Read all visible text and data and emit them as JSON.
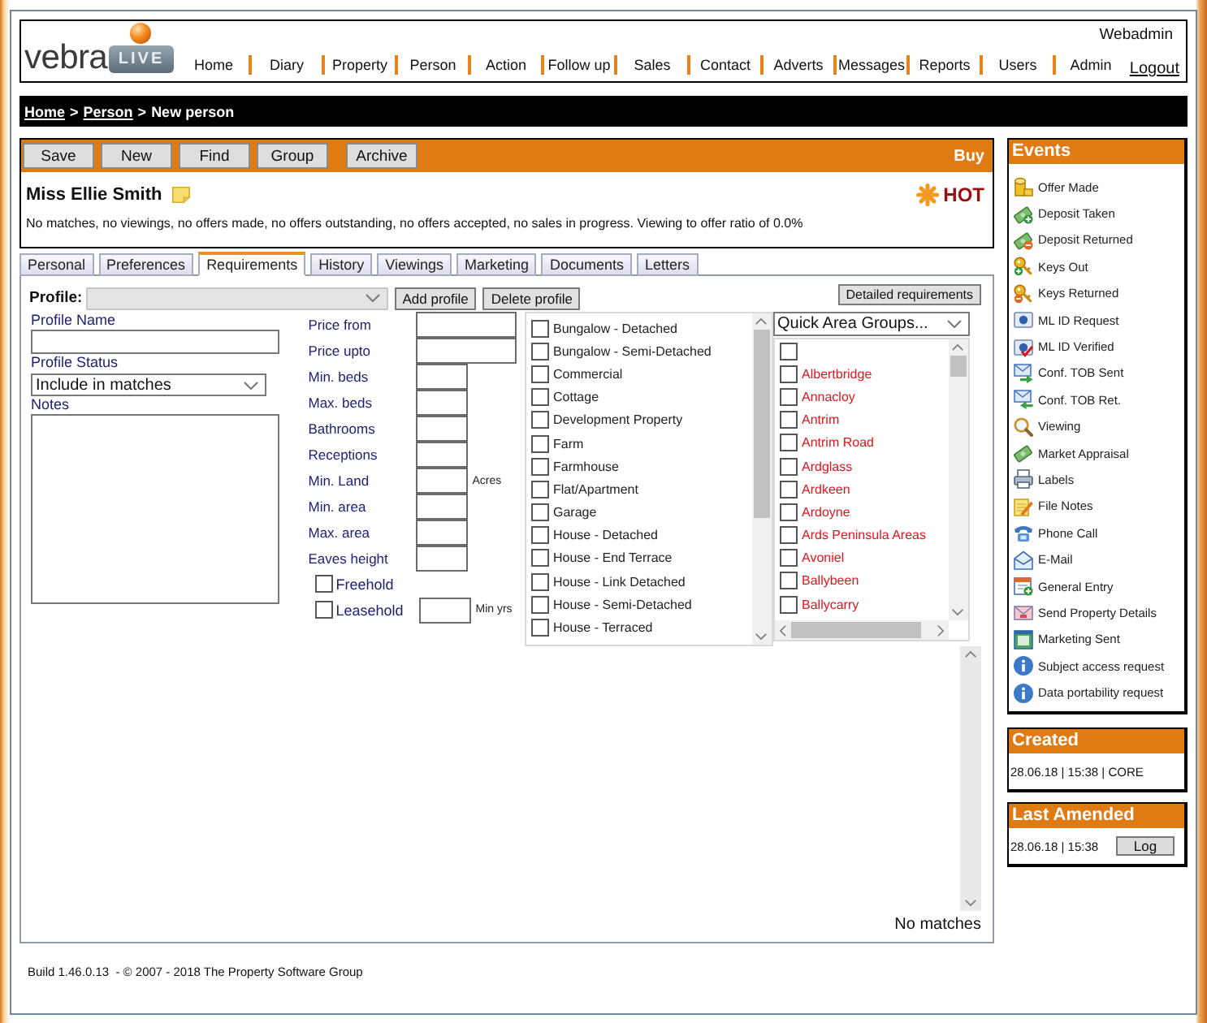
{
  "header": {
    "logo": {
      "wordmark": "vebra",
      "badge": "LIVE"
    },
    "nav": [
      "Home",
      "Diary",
      "Property",
      "Person",
      "Action",
      "Follow up",
      "Sales",
      "Contact",
      "Adverts",
      "Messages",
      "Reports",
      "Users",
      "Admin"
    ],
    "user": "Webadmin",
    "logout": "Logout"
  },
  "breadcrumb": [
    {
      "label": "Home",
      "kind": "link"
    },
    {
      "label": ">",
      "kind": "separator"
    },
    {
      "label": "Person",
      "kind": "link"
    },
    {
      "label": ">",
      "kind": "separator"
    },
    {
      "label": "New person",
      "kind": "current"
    }
  ],
  "toolbar": {
    "button_groups": [
      [
        "Save",
        "New",
        "Find",
        "Group"
      ],
      [
        "Archive"
      ]
    ],
    "mode": "Buy"
  },
  "person": {
    "name": "Miss Ellie Smith",
    "status": "HOT",
    "summary": "No matches, no viewings, no offers made, no offers outstanding, no offers accepted, no sales in progress. Viewing to offer ratio of 0.0%"
  },
  "tabs": [
    {
      "label": "Personal",
      "selected": false
    },
    {
      "label": "Preferences",
      "selected": false
    },
    {
      "label": "Requirements",
      "selected": true
    },
    {
      "label": "History",
      "selected": false
    },
    {
      "label": "Viewings",
      "selected": false
    },
    {
      "label": "Marketing",
      "selected": false
    },
    {
      "label": "Documents",
      "selected": false
    },
    {
      "label": "Letters",
      "selected": false
    }
  ],
  "requirements": {
    "profile": {
      "label": "Profile:",
      "disabled": true
    },
    "profile_buttons": [
      "Add profile",
      "Delete profile"
    ],
    "detailed_button": "Detailed requirements",
    "profile_name": {
      "label": "Profile Name"
    },
    "profile_status": {
      "label": "Profile Status",
      "value": "Include in matches"
    },
    "notes": {
      "label": "Notes"
    },
    "criteria": [
      {
        "label": "Price from",
        "kind": "wide"
      },
      {
        "label": "Price upto",
        "kind": "wide"
      },
      {
        "label": "Min. beds",
        "kind": "narrow"
      },
      {
        "label": "Max. beds",
        "kind": "narrow"
      },
      {
        "label": "Bathrooms",
        "kind": "narrow"
      },
      {
        "label": "Receptions",
        "kind": "narrow"
      },
      {
        "label": "Min. Land",
        "kind": "narrow",
        "unit": "Acres"
      },
      {
        "label": "Min. area",
        "kind": "narrow"
      },
      {
        "label": "Max. area",
        "kind": "narrow"
      },
      {
        "label": "Eaves height",
        "kind": "narrow"
      }
    ],
    "tenure": [
      {
        "label": "Freehold",
        "checked": false
      },
      {
        "label": "Leasehold",
        "checked": false,
        "unit": "Min yrs"
      }
    ],
    "property_types": [
      {
        "label": "Bungalow - Detached",
        "checked": false
      },
      {
        "label": "Bungalow - Semi-Detached",
        "checked": false
      },
      {
        "label": "Commercial",
        "checked": false
      },
      {
        "label": "Cottage",
        "checked": false
      },
      {
        "label": "Development Property",
        "checked": false
      },
      {
        "label": "Farm",
        "checked": false
      },
      {
        "label": "Farmhouse",
        "checked": false
      },
      {
        "label": "Flat/Apartment",
        "checked": false
      },
      {
        "label": "Garage",
        "checked": false
      },
      {
        "label": "House - Detached",
        "checked": false
      },
      {
        "label": "House - End Terrace",
        "checked": false
      },
      {
        "label": "House - Link Detached",
        "checked": false
      },
      {
        "label": "House - Semi-Detached",
        "checked": false
      },
      {
        "label": "House - Terraced",
        "checked": false
      }
    ],
    "area_groups": {
      "value": "Quick Area Groups..."
    },
    "areas": [
      {
        "checked": false
      },
      {
        "label": "Albertbridge",
        "checked": false
      },
      {
        "label": "Annacloy",
        "checked": false
      },
      {
        "label": "Antrim",
        "checked": false
      },
      {
        "label": "Antrim Road",
        "checked": false
      },
      {
        "label": "Ardglass",
        "checked": false
      },
      {
        "label": "Ardkeen",
        "checked": false
      },
      {
        "label": "Ardoyne",
        "checked": false
      },
      {
        "label": "Ards Peninsula Areas",
        "checked": false
      },
      {
        "label": "Avoniel",
        "checked": false
      },
      {
        "label": "Ballybeen",
        "checked": false
      },
      {
        "label": "Ballycarry",
        "checked": false
      }
    ],
    "results": {
      "message": "No matches"
    }
  },
  "footer": "Build 1.46.0.13  - © 2007 - 2018 The Property Software Group",
  "events": {
    "title": "Events",
    "items": [
      {
        "label": "Offer Made",
        "kind": "offer"
      },
      {
        "label": "Deposit Taken",
        "kind": "deposit"
      },
      {
        "label": "Deposit Returned",
        "kind": "refund"
      },
      {
        "label": "Keys Out",
        "kind": "keysout"
      },
      {
        "label": "Keys Returned",
        "kind": "keysin"
      },
      {
        "label": "ML ID Request",
        "kind": "idrequest"
      },
      {
        "label": "ML ID Verified",
        "kind": "idverified"
      },
      {
        "label": "Conf. TOB Sent",
        "kind": "tobsent"
      },
      {
        "label": "Conf. TOB Ret.",
        "kind": "tobreturned"
      },
      {
        "label": "Viewing",
        "kind": "viewing"
      },
      {
        "label": "Market Appraisal",
        "kind": "appraisal"
      },
      {
        "label": "Labels",
        "kind": "labels"
      },
      {
        "label": "File Notes",
        "kind": "notes"
      },
      {
        "label": "Phone Call",
        "kind": "phone"
      },
      {
        "label": "E-Mail",
        "kind": "email"
      },
      {
        "label": "General Entry",
        "kind": "entry"
      },
      {
        "label": "Send Property Details",
        "kind": "details"
      },
      {
        "label": "Marketing Sent",
        "kind": "marketing"
      },
      {
        "label": "Subject access request",
        "kind": "info"
      },
      {
        "label": "Data portability request",
        "kind": "info"
      }
    ]
  },
  "created": {
    "title": "Created",
    "text": "28.06.18 | 15:38 | CORE"
  },
  "last_amended": {
    "title": "Last Amended",
    "text": "28.06.18 | 15:38",
    "button": "Log"
  }
}
